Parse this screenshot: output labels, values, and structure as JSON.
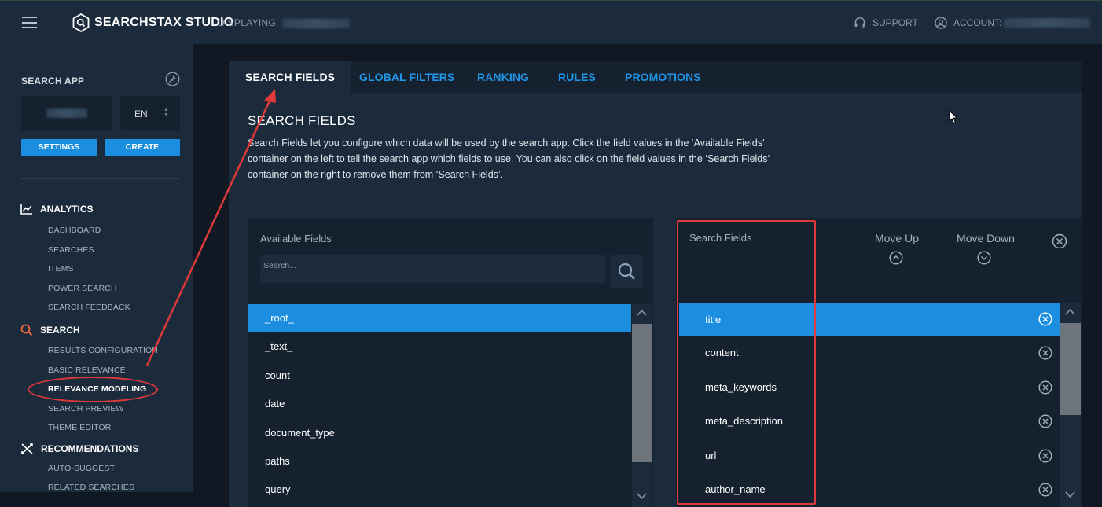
{
  "header": {
    "brand": "SEARCHSTAX STUDIO",
    "displaying_label": "DISPLAYING",
    "support_label": "SUPPORT",
    "account_label": "ACCOUNT:"
  },
  "sidebar": {
    "heading": "SEARCH APP",
    "language": "EN",
    "settings_label": "SETTINGS",
    "create_label": "CREATE",
    "sections": {
      "analytics": "ANALYTICS",
      "search": "SEARCH",
      "recommendations": "RECOMMENDATIONS"
    },
    "analytics_items": [
      "DASHBOARD",
      "SEARCHES",
      "ITEMS",
      "POWER SEARCH",
      "SEARCH FEEDBACK"
    ],
    "search_items": [
      "RESULTS CONFIGURATION",
      "BASIC RELEVANCE",
      "RELEVANCE MODELING",
      "SEARCH PREVIEW",
      "THEME EDITOR"
    ],
    "recommendation_items": [
      "AUTO-SUGGEST",
      "RELATED SEARCHES"
    ]
  },
  "tabs": [
    "SEARCH FIELDS",
    "GLOBAL FILTERS",
    "RANKING",
    "RULES",
    "PROMOTIONS"
  ],
  "content": {
    "title": "SEARCH FIELDS",
    "description": "Search Fields let you configure which data will be used by the search app. Click the field values in the ‘Available Fields’ container on the left to tell the search app which fields to use. You can also click on the field values in the ‘Search Fields’ container on the right to remove them from ‘Search Fields’."
  },
  "available_fields": {
    "title": "Available Fields",
    "search_placeholder": "Search...",
    "items": [
      "_root_",
      "_text_",
      "count",
      "date",
      "document_type",
      "paths",
      "query"
    ],
    "selected": "_root_"
  },
  "search_fields": {
    "title": "Search Fields",
    "move_up_label": "Move Up",
    "move_down_label": "Move Down",
    "items": [
      "title",
      "content",
      "meta_keywords",
      "meta_description",
      "url",
      "author_name"
    ],
    "selected": "title"
  },
  "colors": {
    "accent": "#1b8ee0",
    "annotation": "#e0393b",
    "panel": "#1c2b3c",
    "background": "#0f1823"
  }
}
